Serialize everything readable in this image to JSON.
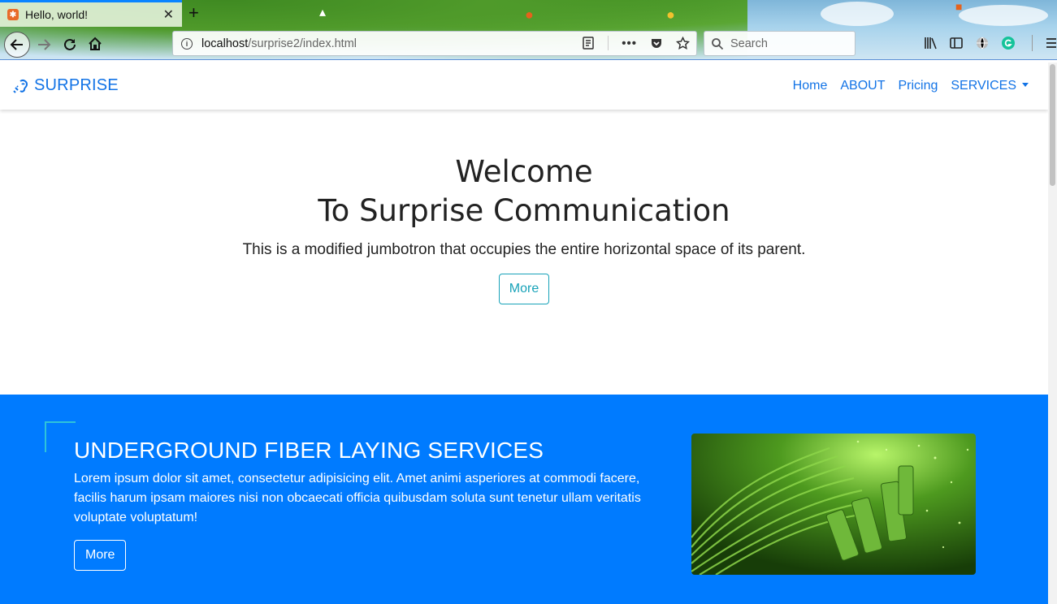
{
  "browser": {
    "tab_title": "Hello, world!",
    "tab_close": "✕",
    "new_tab": "+",
    "url_host": "localhost",
    "url_path": "/surprise2/index.html",
    "search_placeholder": "Search",
    "accent_color": "#0a84ff"
  },
  "site": {
    "brand": "SURPRISE",
    "nav": {
      "home": "Home",
      "about": "ABOUT",
      "pricing": "Pricing",
      "services": "SERVICES"
    },
    "jumbotron": {
      "line1": "Welcome",
      "line2": "To Surprise Communication",
      "lead": "This is a modified jumbotron that occupies the entire horizontal space of its parent.",
      "button": "More"
    },
    "service": {
      "title": "UNDERGROUND FIBER LAYING SERVICES",
      "body": "Lorem ipsum dolor sit amet, consectetur adipisicing elit. Amet animi asperiores at commodi facere, facilis harum ipsam maiores nisi non obcaecati officia quibusdam soluta sunt tenetur ullam veritatis voluptate voluptatum!",
      "button": "More",
      "background_color": "#007bff"
    },
    "colors": {
      "brand_blue": "#1273e6",
      "outline_teal": "#17a2b8"
    }
  }
}
